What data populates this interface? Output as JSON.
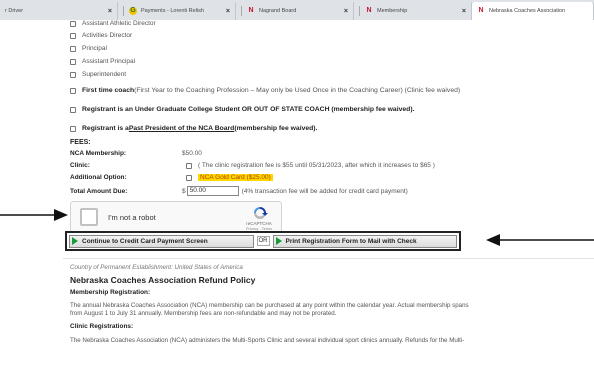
{
  "browser": {
    "tabs": [
      {
        "title": "r Driver",
        "favicon": "",
        "active": false
      },
      {
        "title": "Payments - Lorenti Relish",
        "favicon": "google-icon",
        "active": false
      },
      {
        "title": "Nagrand Board",
        "favicon": "nebraska-n-icon",
        "active": false
      },
      {
        "title": "Membership",
        "favicon": "nebraska-n-icon",
        "active": false
      },
      {
        "title": "Nebraska Coaches Association",
        "favicon": "nebraska-n-icon",
        "active": true
      }
    ],
    "close_glyph": "×"
  },
  "roles": [
    "Assistant Athletic Director",
    "Activities Director",
    "Principal",
    "Assistant Principal",
    "Superintendent"
  ],
  "special_options": {
    "first_time": {
      "bold": "First time coach",
      "rest": " (First Year to the Coaching Profession – May only be Used Once in the Coaching Career) (Clinic fee waived)"
    },
    "student": "Registrant is an Under Graduate College Student OR OUT OF STATE COACH (membership fee waived).",
    "past_president": {
      "prefix": "Registrant is a ",
      "link": "Past President of the NCA Board",
      "suffix": " (membership fee waived)."
    }
  },
  "fees": {
    "heading": "FEES:",
    "membership_label": "NCA Membership:",
    "membership_value": "$50.00",
    "clinic_label": "Clinic:",
    "clinic_note": "( The clinic registration fee is $55 until 05/31/2023, after which it increases to $65 )",
    "additional_label": "Additional Option:",
    "additional_value": "NCA Gold Card ($25.00)",
    "total_label": "Total Amount Due:",
    "currency": "$",
    "total_value": "50.00",
    "total_note": "(4% transaction fee will be added for credit card payment)"
  },
  "captcha": {
    "label": "I'm not a robot",
    "brand": "reCAPTCHA",
    "links": "Privacy - Terms"
  },
  "actions": {
    "credit_card": "Continue to Credit Card Payment Screen",
    "or": "OR",
    "mail_check": "Print Registration Form to Mail with Check"
  },
  "country_note": "Country of Permanent Establishment: United States of America",
  "refund": {
    "title": "Nebraska Coaches Association Refund Policy",
    "membership_heading": "Membership Registration:",
    "membership_text_1": "The annual Nebraska Coaches Association (NCA) membership can be purchased at any point within the calendar year. Actual membership spans",
    "membership_text_2": "from August 1 to July 31 annually. Membership fees are non-refundable and may not be prorated.",
    "clinic_heading": "Clinic Registrations:",
    "clinic_text": "The Nebraska Coaches Association (NCA) administers the Multi-Sports Clinic and several individual sport clinics annually. Refunds for the Multi-"
  },
  "colors": {
    "nebraska_red": "#c8102e",
    "play_green": "#1a9a3a",
    "highlight_yellow": "#ffd800",
    "highlight_text": "#b04000"
  }
}
